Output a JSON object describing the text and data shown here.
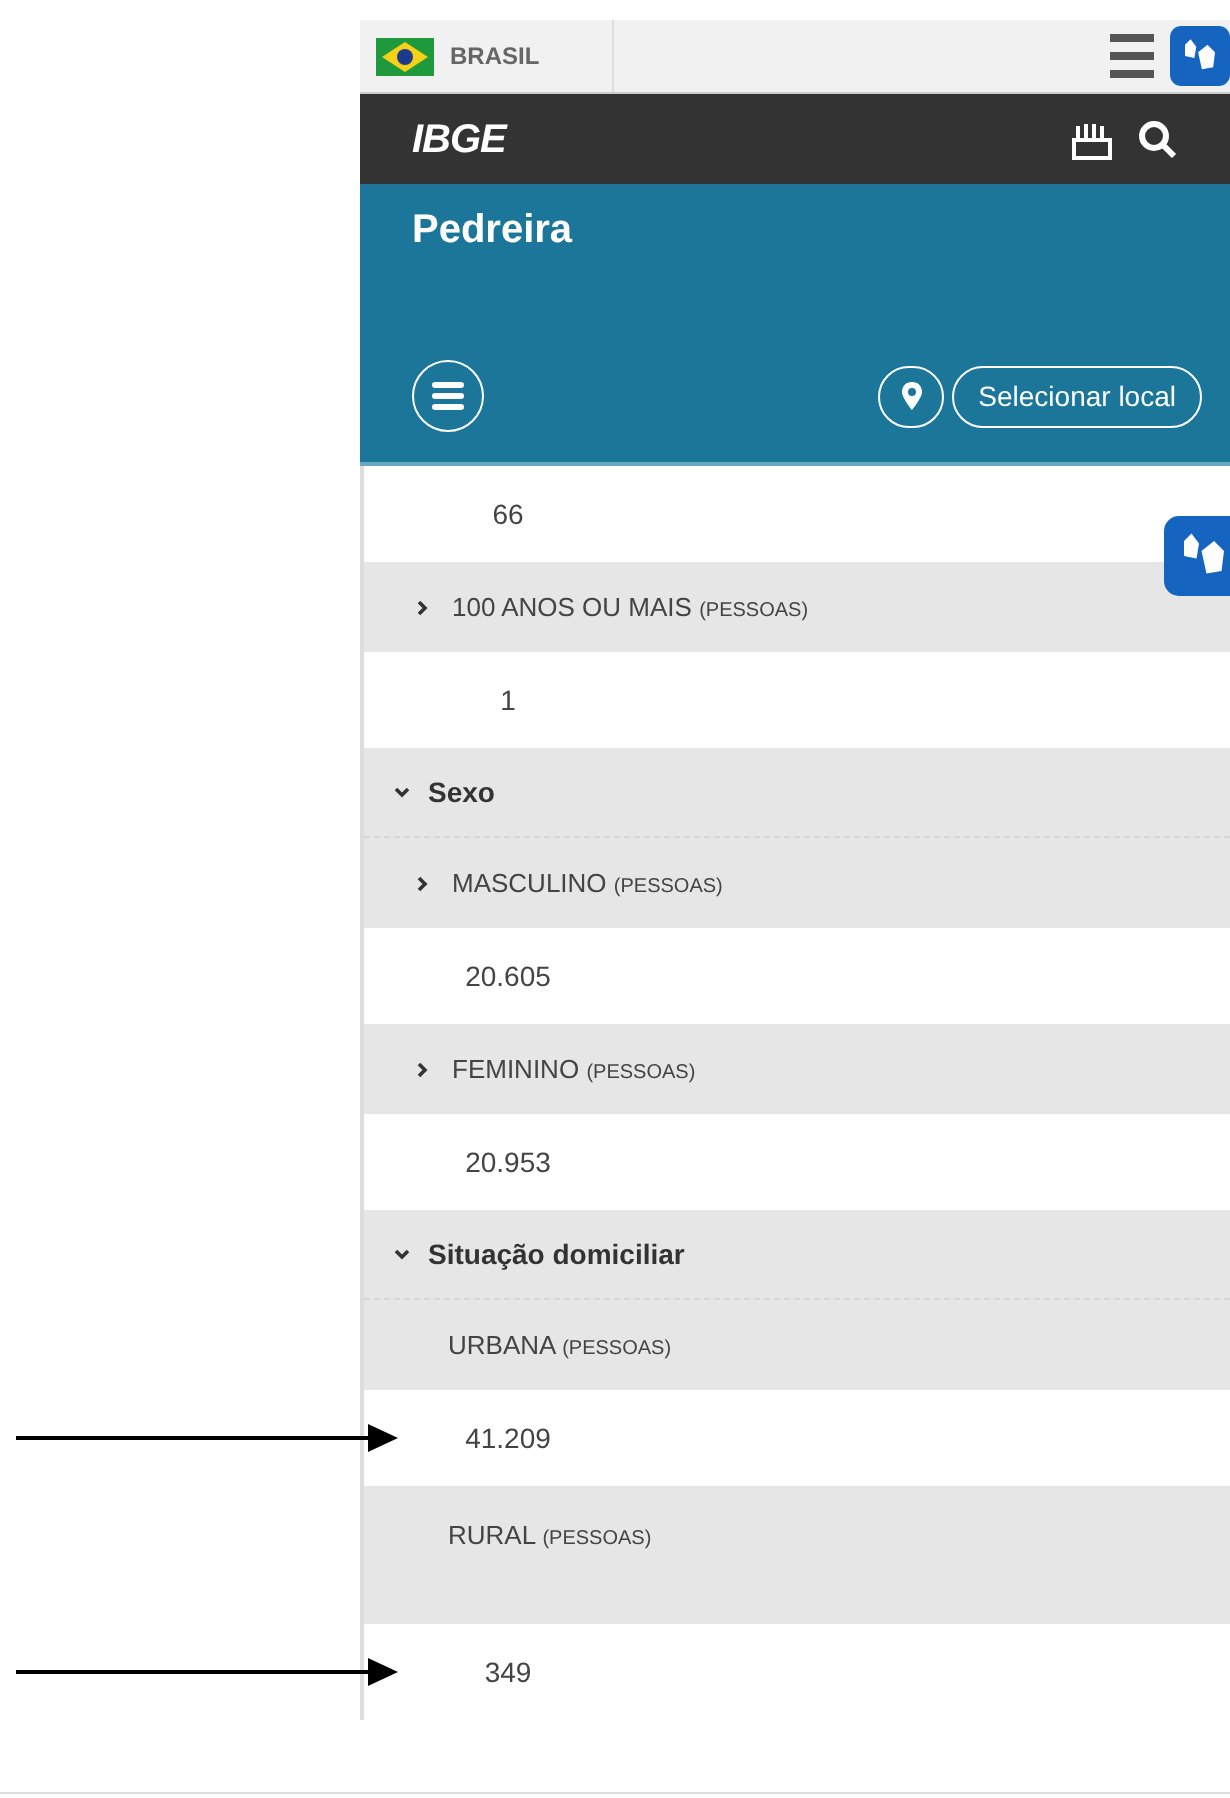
{
  "top_bar": {
    "country": "BRASIL"
  },
  "header": {
    "logo": "IBGE"
  },
  "place": {
    "title": "Pedreira",
    "select_label": "Selecionar local"
  },
  "rows": [
    {
      "kind": "value",
      "text": "66"
    },
    {
      "kind": "item",
      "label": "100 ANOS OU MAIS",
      "unit": "(PESSOAS)",
      "expanded": false
    },
    {
      "kind": "value",
      "text": "1"
    },
    {
      "kind": "section",
      "label": "Sexo",
      "expanded": true
    },
    {
      "kind": "item",
      "label": "MASCULINO",
      "unit": "(PESSOAS)",
      "expanded": false
    },
    {
      "kind": "value",
      "text": "20.605"
    },
    {
      "kind": "item",
      "label": "FEMININO",
      "unit": "(PESSOAS)",
      "expanded": false
    },
    {
      "kind": "value",
      "text": "20.953"
    },
    {
      "kind": "section",
      "label": "Situação domiciliar",
      "expanded": true
    },
    {
      "kind": "item",
      "label": "URBANA",
      "unit": "(PESSOAS)"
    },
    {
      "kind": "value",
      "text": "41.209",
      "marked": true
    },
    {
      "kind": "item",
      "label": "RURAL",
      "unit": "(PESSOAS)",
      "tall": true
    },
    {
      "kind": "value",
      "text": "349",
      "marked": true
    }
  ]
}
